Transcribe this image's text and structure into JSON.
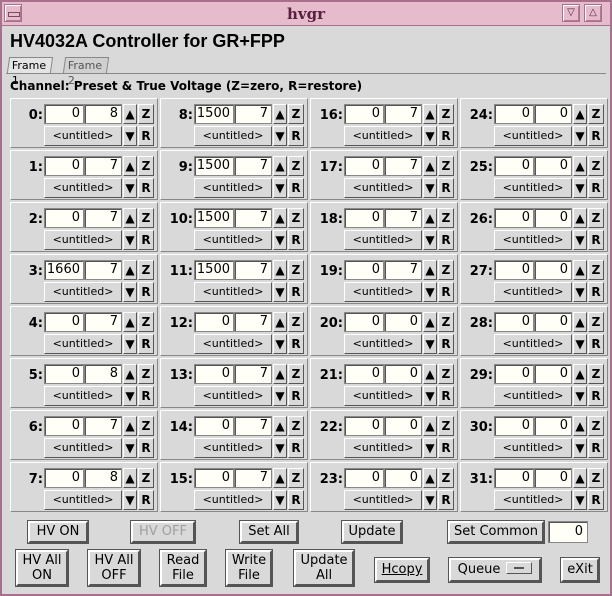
{
  "window": {
    "title": "hvgr",
    "min_glyph": "▽",
    "max_glyph": "△"
  },
  "app_title": "HV4032A Controller for GR+FPP",
  "tabs": [
    "Frame 1",
    "Frame 2"
  ],
  "channel_label": "Channel: Preset & True Voltage (Z=zero, R=restore)",
  "cell_glyphs": {
    "up": "▲",
    "down": "▼",
    "zero": "Z",
    "restore": "R"
  },
  "channels": [
    {
      "id": "0:",
      "preset": "0",
      "true": "8",
      "name": "<untitled>"
    },
    {
      "id": "1:",
      "preset": "0",
      "true": "7",
      "name": "<untitled>"
    },
    {
      "id": "2:",
      "preset": "0",
      "true": "7",
      "name": "<untitled>"
    },
    {
      "id": "3:",
      "preset": "1660",
      "true": "7",
      "name": "<untitled>"
    },
    {
      "id": "4:",
      "preset": "0",
      "true": "7",
      "name": "<untitled>"
    },
    {
      "id": "5:",
      "preset": "0",
      "true": "8",
      "name": "<untitled>"
    },
    {
      "id": "6:",
      "preset": "0",
      "true": "7",
      "name": "<untitled>"
    },
    {
      "id": "7:",
      "preset": "0",
      "true": "8",
      "name": "<untitled>"
    },
    {
      "id": "8:",
      "preset": "1500",
      "true": "7",
      "name": "<untitled>"
    },
    {
      "id": "9:",
      "preset": "1500",
      "true": "7",
      "name": "<untitled>"
    },
    {
      "id": "10:",
      "preset": "1500",
      "true": "7",
      "name": "<untitled>"
    },
    {
      "id": "11:",
      "preset": "1500",
      "true": "7",
      "name": "<untitled>"
    },
    {
      "id": "12:",
      "preset": "0",
      "true": "7",
      "name": "<untitled>"
    },
    {
      "id": "13:",
      "preset": "0",
      "true": "7",
      "name": "<untitled>"
    },
    {
      "id": "14:",
      "preset": "0",
      "true": "7",
      "name": "<untitled>"
    },
    {
      "id": "15:",
      "preset": "0",
      "true": "7",
      "name": "<untitled>"
    },
    {
      "id": "16:",
      "preset": "0",
      "true": "7",
      "name": "<untitled>"
    },
    {
      "id": "17:",
      "preset": "0",
      "true": "7",
      "name": "<untitled>"
    },
    {
      "id": "18:",
      "preset": "0",
      "true": "7",
      "name": "<untitled>"
    },
    {
      "id": "19:",
      "preset": "0",
      "true": "7",
      "name": "<untitled>"
    },
    {
      "id": "20:",
      "preset": "0",
      "true": "0",
      "name": "<untitled>"
    },
    {
      "id": "21:",
      "preset": "0",
      "true": "0",
      "name": "<untitled>"
    },
    {
      "id": "22:",
      "preset": "0",
      "true": "0",
      "name": "<untitled>"
    },
    {
      "id": "23:",
      "preset": "0",
      "true": "0",
      "name": "<untitled>"
    },
    {
      "id": "24:",
      "preset": "0",
      "true": "0",
      "name": "<untitled>"
    },
    {
      "id": "25:",
      "preset": "0",
      "true": "0",
      "name": "<untitled>"
    },
    {
      "id": "26:",
      "preset": "0",
      "true": "0",
      "name": "<untitled>"
    },
    {
      "id": "27:",
      "preset": "0",
      "true": "0",
      "name": "<untitled>"
    },
    {
      "id": "28:",
      "preset": "0",
      "true": "0",
      "name": "<untitled>"
    },
    {
      "id": "29:",
      "preset": "0",
      "true": "0",
      "name": "<untitled>"
    },
    {
      "id": "30:",
      "preset": "0",
      "true": "0",
      "name": "<untitled>"
    },
    {
      "id": "31:",
      "preset": "0",
      "true": "0",
      "name": "<untitled>"
    }
  ],
  "controls": {
    "hv_on": "HV ON",
    "hv_off": "HV OFF",
    "set_all": "Set All",
    "update": "Update",
    "set_common": "Set Common",
    "common_value": "0"
  },
  "bottom": {
    "hv_all_on": [
      "HV All",
      "ON"
    ],
    "hv_all_off": [
      "HV All",
      "OFF"
    ],
    "read_file": [
      "Read",
      "File"
    ],
    "write_file": [
      "Write",
      "File"
    ],
    "update_all": [
      "Update",
      "All"
    ],
    "hcopy": "Hcopy",
    "queue": "Queue",
    "exit": "eXit"
  },
  "colors": {
    "titlebar": "#e6bccd",
    "frame": "#a8708c",
    "panel": "#d9d9d9",
    "field": "#fffef7",
    "disabled_text": "#a0a0a0"
  }
}
